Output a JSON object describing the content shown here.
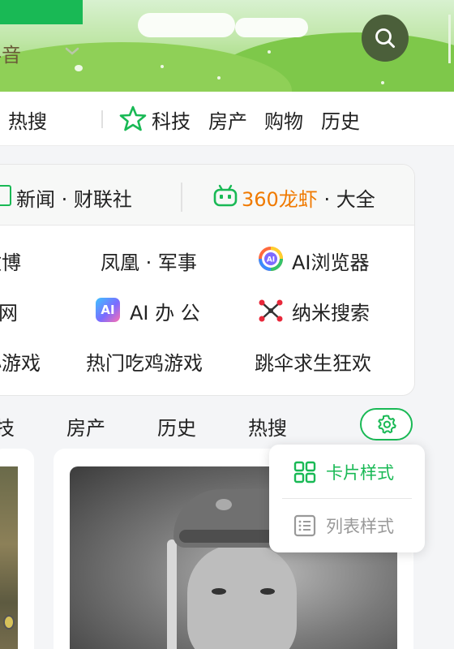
{
  "header": {
    "partial_label": "抖音",
    "search_label": "search"
  },
  "categories": [
    "热搜",
    "科技",
    "房产",
    "购物",
    "历史"
  ],
  "links_card": {
    "head_left": "新闻 · 财联社",
    "head_right_highlight": "360龙虾",
    "head_right_suffix": " · 大全",
    "rows": [
      [
        "微博",
        "凤凰 · 军事",
        "AI浏览器"
      ],
      [
        "网",
        "AI 办 公",
        "纳米搜索"
      ],
      [
        "小游戏",
        "热门吃鸡游戏",
        "跳伞求生狂欢"
      ]
    ]
  },
  "tabs2": [
    "技",
    "房产",
    "历史",
    "热搜"
  ],
  "popup": {
    "card_style": "卡片样式",
    "list_style": "列表样式"
  },
  "colors": {
    "accent": "#19b955",
    "orange": "#f07a00"
  }
}
